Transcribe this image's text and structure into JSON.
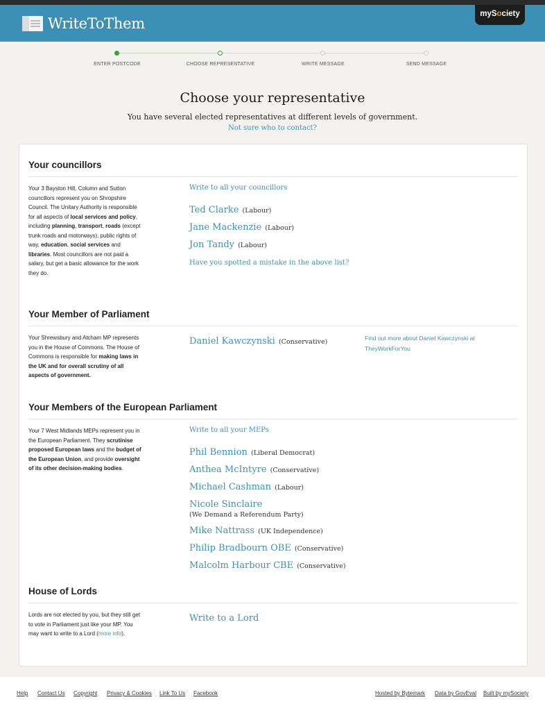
{
  "header": {
    "logo_text": "WriteToThem",
    "mysociety_prefix": "myS",
    "mysociety_o": "o",
    "mysociety_suffix": "ciety"
  },
  "steps": [
    {
      "label": "ENTER POSTCODE",
      "state": "done"
    },
    {
      "label": "CHOOSE REPRESENTATIVE",
      "state": "current"
    },
    {
      "label": "WRITE MESSAGE",
      "state": "todo"
    },
    {
      "label": "SEND MESSAGE",
      "state": "todo"
    }
  ],
  "page": {
    "title": "Choose your representative",
    "intro": "You have several elected representatives at different levels of government.",
    "intro_link": "Not sure who to contact?"
  },
  "councillors": {
    "heading": "Your councillors",
    "desc_1": "Your 3 Bayston Hill, Column and Sutton councillors represent you on Shropshire Council. The Unitary Authority is responsible for all aspects of ",
    "desc_b1": "local services and policy",
    "desc_2": ", including ",
    "desc_b2": "planning",
    "desc_3": ", ",
    "desc_b3": "transport",
    "desc_4": ", ",
    "desc_b4": "roads",
    "desc_5": " (except trunk roads and motorways), public rights of way, ",
    "desc_b5": "education",
    "desc_6": ", ",
    "desc_b6": "social services",
    "desc_7": " and ",
    "desc_b7": "libraries",
    "desc_8": ". Most councillors are not paid a salary, but get a basic allowance for the work they do.",
    "write_all": "Write to all your councillors",
    "reps": [
      {
        "name": "Ted Clarke",
        "party": "(Labour)"
      },
      {
        "name": "Jane Mackenzie",
        "party": "(Labour)"
      },
      {
        "name": "Jon Tandy",
        "party": "(Labour)"
      }
    ],
    "mistake_link": "Have you spotted a mistake in the above list?"
  },
  "mp": {
    "heading": "Your Member of Parliament",
    "desc_1": "Your Shrewsbury and Atcham MP represents you in the House of Commons. The House of Commons is responsible for ",
    "desc_b1": "making laws in the UK and for overall scrutiny of all aspects of government.",
    "rep_name": "Daniel Kawczynski",
    "rep_party": "(Conservative)",
    "twfy_link": "Find out more about Daniel Kawczynski at TheyWorkForYou"
  },
  "meps": {
    "heading": "Your Members of the European Parliament",
    "desc_1": "Your 7 West Midlands MEPs represent you in the European Parliament. They ",
    "desc_b1": "scrutinise proposed European laws",
    "desc_2": " and the ",
    "desc_b2": "budget of the European Union",
    "desc_3": ", and provide ",
    "desc_b3": "oversight of its other decision-making bodies",
    "desc_4": ".",
    "write_all": "Write to all your MEPs",
    "reps": [
      {
        "name": "Phil Bennion",
        "party": "(Liberal Democrat)"
      },
      {
        "name": "Anthea McIntyre",
        "party": "(Conservative)"
      },
      {
        "name": "Michael Cashman",
        "party": "(Labour)"
      },
      {
        "name": "Nicole Sinclaire",
        "party": "(We Demand a Referendum Party)"
      },
      {
        "name": "Mike Nattrass",
        "party": "(UK Independence)"
      },
      {
        "name": "Philip Bradbourn OBE",
        "party": "(Conservative)"
      },
      {
        "name": "Malcolm Harbour CBE",
        "party": "(Conservative)"
      }
    ]
  },
  "lords": {
    "heading": "House of Lords",
    "desc_1": "Lords are not elected by you, but they still get to vote in Parliament just like your MP. You may want to write to a Lord (",
    "desc_link": "more info",
    "desc_2": ").",
    "write_link": "Write to a Lord"
  },
  "footer": {
    "left": [
      "Help",
      "Contact Us",
      "Copyright",
      "Privacy & Cookies",
      "Link To Us",
      "Facebook"
    ],
    "right": [
      "Hosted by Bytemark",
      "Data by GovEval",
      "Built by mySociety"
    ]
  }
}
